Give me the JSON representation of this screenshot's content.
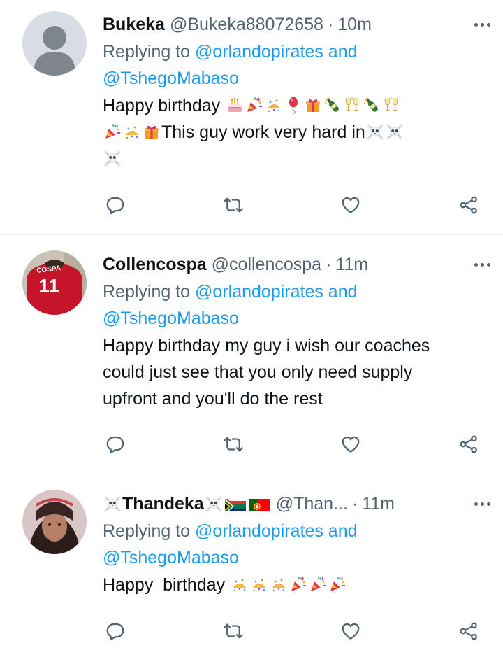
{
  "tweets": [
    {
      "name": "Bukeka",
      "handle": "@Bukeka88072658",
      "separator": "·",
      "time": "10m",
      "replying_prefix": "Replying to ",
      "replying_user1": "@orlandopirates",
      "replying_and": " and",
      "replying_user2": "@TshegoMabaso",
      "text_line1": "Happy birthday",
      "text_line2": "This guy work very hard in",
      "avatar": "default-profile-placeholder"
    },
    {
      "name": "Collencospa",
      "handle": "@collencospa",
      "separator": "·",
      "time": "11m",
      "replying_prefix": "Replying to ",
      "replying_user1": "@orlandopirates",
      "replying_and": " and",
      "replying_user2": "@TshegoMabaso",
      "text": "Happy birthday my guy i wish our coaches could just see that you only need supply upfront and you'll do the rest",
      "avatar": "photo-red-jersey",
      "jersey_text": "COSPA",
      "jersey_number": "11"
    },
    {
      "name": "Thandeka",
      "handle": "@Than...",
      "separator": "·",
      "time": "11m",
      "replying_prefix": "Replying to ",
      "replying_user1": "@orlandopirates",
      "replying_and": " and",
      "replying_user2": "@TshegoMabaso",
      "text": "Happy  birthday",
      "avatar": "photo-person"
    }
  ],
  "icons": {
    "reply": "reply-icon",
    "retweet": "retweet-icon",
    "like": "like-icon",
    "share": "share-icon",
    "more": "more-icon"
  },
  "colors": {
    "link": "#1d9bf0",
    "secondary": "#536471",
    "divider": "#e6ecf0"
  }
}
